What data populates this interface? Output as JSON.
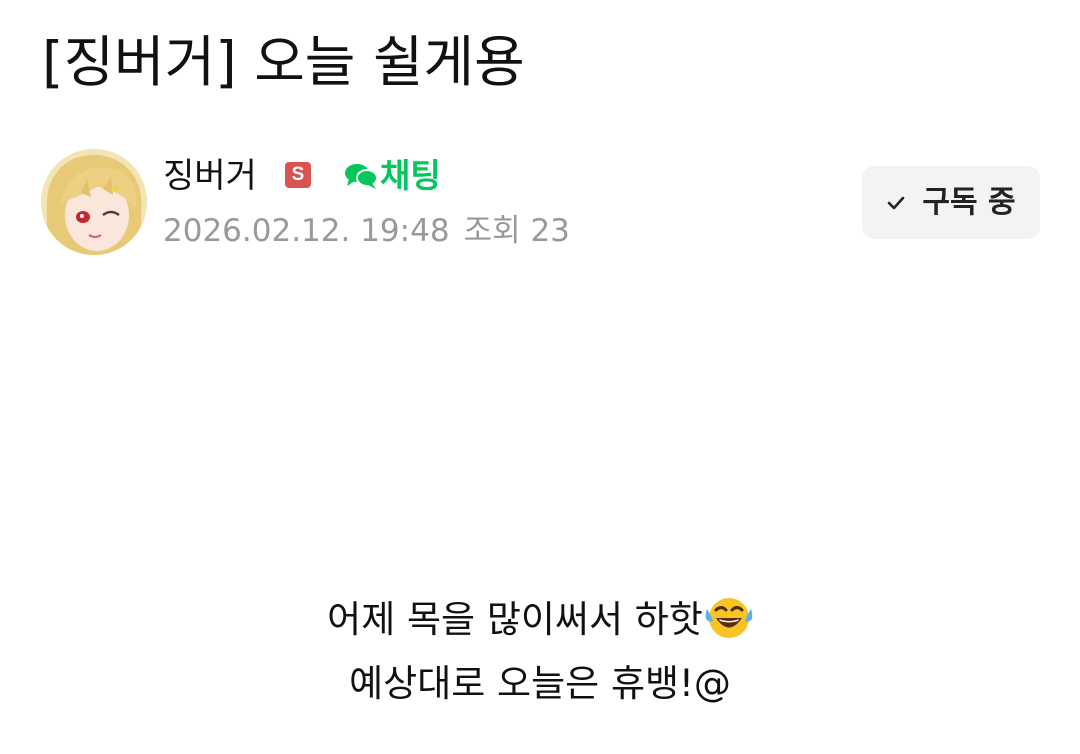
{
  "post": {
    "title": "[징버거] 오늘 쉴게용"
  },
  "author": {
    "name": "징버거",
    "badge": "S",
    "chat_label": "채팅",
    "date": "2026.02.12. 19:48",
    "views_label": "조회 23"
  },
  "subscribe": {
    "label": "구독 중"
  },
  "body": {
    "line1": "어제 목을 많이써서 하핫",
    "line2": "예상대로 오늘은 휴뱅!@",
    "emoji": "face-with-tears-of-joy-icon"
  },
  "colors": {
    "accent_green": "#03c75a",
    "badge_red": "#d9534f",
    "meta_gray": "#999999",
    "button_bg": "#f1f3f5"
  }
}
